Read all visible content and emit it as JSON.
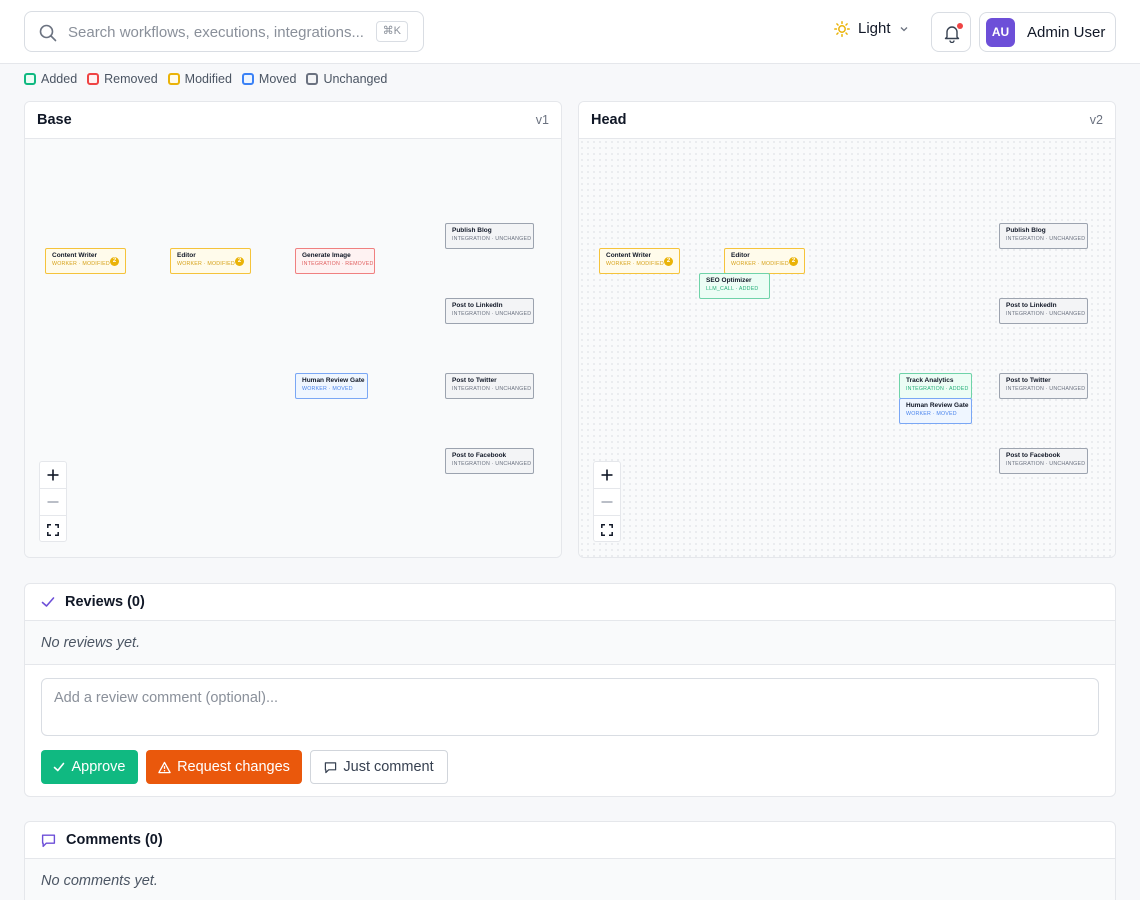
{
  "search": {
    "placeholder": "Search workflows, executions, integrations...",
    "shortcut": "⌘K",
    "icon": "search-icon"
  },
  "theme": {
    "label": "Light",
    "icon": "sun-icon",
    "color": "#eab308"
  },
  "notifications": {
    "icon": "bell-icon",
    "has_unread": true
  },
  "user": {
    "initials": "AU",
    "name": "Admin User",
    "avatar_color": "#6d4fd8"
  },
  "legend": [
    {
      "label": "Added",
      "color": "#10b981"
    },
    {
      "label": "Removed",
      "color": "#ef4444"
    },
    {
      "label": "Modified",
      "color": "#eab308"
    },
    {
      "label": "Moved",
      "color": "#3b82f6"
    },
    {
      "label": "Unchanged",
      "color": "#6b7280"
    }
  ],
  "base": {
    "title": "Base",
    "version": "v1",
    "nodes": [
      {
        "title": "Content Writer",
        "subtitle": "WORKER · MODIFIED",
        "badge": "2",
        "status": "modified"
      },
      {
        "title": "Editor",
        "subtitle": "WORKER · MODIFIED",
        "badge": "2",
        "status": "modified"
      },
      {
        "title": "Generate Image",
        "subtitle": "INTEGRATION · REMOVED",
        "status": "removed"
      },
      {
        "title": "Publish Blog",
        "subtitle": "INTEGRATION · UNCHANGED",
        "status": "unchanged"
      },
      {
        "title": "Post to LinkedIn",
        "subtitle": "INTEGRATION · UNCHANGED",
        "status": "unchanged"
      },
      {
        "title": "Human Review Gate",
        "subtitle": "WORKER · MOVED",
        "status": "moved"
      },
      {
        "title": "Post to Twitter",
        "subtitle": "INTEGRATION · UNCHANGED",
        "status": "unchanged"
      },
      {
        "title": "Post to Facebook",
        "subtitle": "INTEGRATION · UNCHANGED",
        "status": "unchanged"
      }
    ]
  },
  "head": {
    "title": "Head",
    "version": "v2",
    "nodes": [
      {
        "title": "Content Writer",
        "subtitle": "WORKER · MODIFIED",
        "badge": "2",
        "status": "modified"
      },
      {
        "title": "Editor",
        "subtitle": "WORKER · MODIFIED",
        "badge": "2",
        "status": "modified"
      },
      {
        "title": "SEO Optimizer",
        "subtitle": "LLM_CALL · ADDED",
        "status": "added"
      },
      {
        "title": "Publish Blog",
        "subtitle": "INTEGRATION · UNCHANGED",
        "status": "unchanged"
      },
      {
        "title": "Post to LinkedIn",
        "subtitle": "INTEGRATION · UNCHANGED",
        "status": "unchanged"
      },
      {
        "title": "Track Analytics",
        "subtitle": "INTEGRATION · ADDED",
        "status": "added"
      },
      {
        "title": "Human Review Gate",
        "subtitle": "WORKER · MOVED",
        "status": "moved"
      },
      {
        "title": "Post to Twitter",
        "subtitle": "INTEGRATION · UNCHANGED",
        "status": "unchanged"
      },
      {
        "title": "Post to Facebook",
        "subtitle": "INTEGRATION · UNCHANGED",
        "status": "unchanged"
      }
    ]
  },
  "zoom_controls": {
    "zoom_in": "+",
    "zoom_out": "—",
    "fit": "fit-view-icon"
  },
  "reviews": {
    "title": "Reviews (0)",
    "empty": "No reviews yet.",
    "comment_placeholder": "Add a review comment (optional)...",
    "approve_label": "Approve",
    "request_changes_label": "Request changes",
    "just_comment_label": "Just comment"
  },
  "comments": {
    "title": "Comments (0)",
    "empty": "No comments yet."
  }
}
